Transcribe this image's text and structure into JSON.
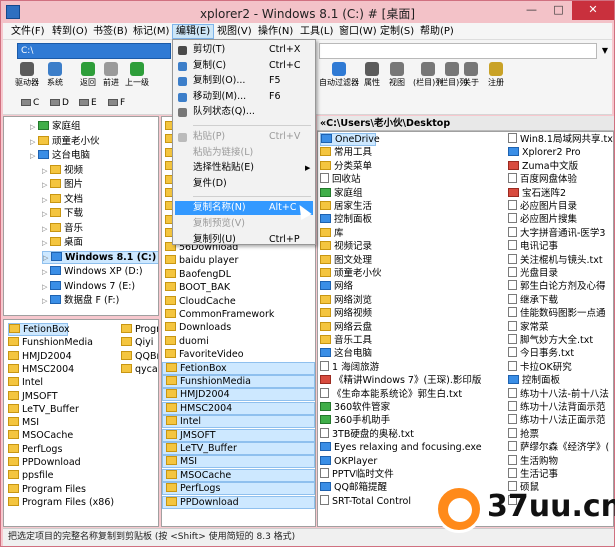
{
  "window": {
    "title": "xplorer2 - Windows 8.1 (C:) # [桌面]",
    "min": "—",
    "max": "□",
    "close": "✕"
  },
  "menubar": [
    "文件(F)",
    "转到(O)",
    "书签(B)",
    "标记(M)",
    "编辑(E)",
    "视图(V)",
    "操作(N)",
    "工具(L)",
    "窗口(W)",
    "定制(S)",
    "帮助(P)"
  ],
  "address": {
    "left_value": "C:\\",
    "right_value": ""
  },
  "toolbar": {
    "left": [
      "驱动器",
      "系统",
      "返回",
      "前进",
      "上一级"
    ],
    "right": [
      "自动过滤器",
      "属性",
      "视图",
      "(栏目)列",
      "(栏目)列",
      "关于",
      "注册"
    ]
  },
  "drives": [
    "C",
    "D",
    "E",
    "F"
  ],
  "tree": [
    {
      "label": "家庭组",
      "indent": 1,
      "icon": "green"
    },
    {
      "label": "顽童老小伙",
      "indent": 1,
      "icon": "folder"
    },
    {
      "label": "这台电脑",
      "indent": 1,
      "icon": "blue"
    },
    {
      "label": "视频",
      "indent": 2,
      "icon": "folder"
    },
    {
      "label": "图片",
      "indent": 2,
      "icon": "folder"
    },
    {
      "label": "文档",
      "indent": 2,
      "icon": "folder"
    },
    {
      "label": "下载",
      "indent": 2,
      "icon": "folder"
    },
    {
      "label": "音乐",
      "indent": 2,
      "icon": "folder"
    },
    {
      "label": "桌面",
      "indent": 2,
      "icon": "folder"
    },
    {
      "label": "Windows 8.1 (C:)",
      "indent": 2,
      "icon": "blue",
      "selected": true
    },
    {
      "label": "Windows XP (D:)",
      "indent": 2,
      "icon": "blue"
    },
    {
      "label": "Windows 7 (E:)",
      "indent": 2,
      "icon": "blue"
    },
    {
      "label": "数据盘 F (F:)",
      "indent": 2,
      "icon": "blue"
    }
  ],
  "bottom_left": {
    "col1": [
      "FetionBox",
      "FunshionMedia",
      "HMJD2004",
      "HMSC2004",
      "Intel",
      "JMSOFT",
      "LeTV_Buffer",
      "MSI",
      "MSOCache",
      "PerfLogs",
      "PPDownload",
      "ppsfile",
      "Program Files",
      "Program Files (x86)"
    ],
    "col2": [
      "Progr",
      "Qiyi",
      "QQBr",
      "qycac"
    ]
  },
  "middle_list": [
    "56Download",
    "baidu player",
    "BaofengDL",
    "BOOT_BAK",
    "CloudCache",
    "CommonFramework",
    "Downloads",
    "duomi",
    "FavoriteVideo",
    "FetionBox",
    "FunshionMedia",
    "HMJD2004",
    "HMSC2004",
    "Intel",
    "JMSOFT",
    "LeTV_Buffer",
    "MSI",
    "MSOCache",
    "PerfLogs",
    "PPDownload"
  ],
  "middle_selected_from": 9,
  "right_pane": {
    "path": "«C:\\Users\\老小伙\\Desktop",
    "col1": [
      {
        "label": "OneDrive",
        "icon": "blue"
      },
      {
        "label": "常用工具",
        "icon": "folder"
      },
      {
        "label": "分类菜单",
        "icon": "folder"
      },
      {
        "label": "回收站",
        "icon": "file"
      },
      {
        "label": "家庭组",
        "icon": "green"
      },
      {
        "label": "居家生活",
        "icon": "folder"
      },
      {
        "label": "控制面板",
        "icon": "blue"
      },
      {
        "label": "库",
        "icon": "folder"
      },
      {
        "label": "视频记录",
        "icon": "folder"
      },
      {
        "label": "图文处理",
        "icon": "folder"
      },
      {
        "label": "顽童老小伙",
        "icon": "folder"
      },
      {
        "label": "网络",
        "icon": "blue"
      },
      {
        "label": "网络浏览",
        "icon": "folder"
      },
      {
        "label": "网络视频",
        "icon": "folder"
      },
      {
        "label": "网络云盘",
        "icon": "folder"
      },
      {
        "label": "音乐工具",
        "icon": "folder"
      },
      {
        "label": "这台电脑",
        "icon": "blue"
      },
      {
        "label": "1 海阔旅游",
        "icon": "file"
      },
      {
        "label": "《精讲Windows 7》(王琛).影印版",
        "icon": "red"
      },
      {
        "label": "《生命本能系统论》郭生白.txt",
        "icon": "file"
      },
      {
        "label": "360软件管家",
        "icon": "green"
      },
      {
        "label": "360手机助手",
        "icon": "green"
      },
      {
        "label": "3TB硬盘的奥秘.txt",
        "icon": "file"
      },
      {
        "label": "Eyes relaxing and focusing.exe",
        "icon": "blue"
      },
      {
        "label": "OKPlayer",
        "icon": "blue"
      },
      {
        "label": "PPTV临时文件",
        "icon": "file"
      },
      {
        "label": "QQ邮箱提醒",
        "icon": "blue"
      },
      {
        "label": "SRT-Total Control",
        "icon": "file"
      }
    ],
    "col2": [
      {
        "label": "Win8.1局域网共享.txt",
        "icon": "file"
      },
      {
        "label": "Xplorer2 Pro",
        "icon": "blue"
      },
      {
        "label": "Zuma中文版",
        "icon": "red"
      },
      {
        "label": "百度网盘体验",
        "icon": "file"
      },
      {
        "label": "宝石迷阵2",
        "icon": "red"
      },
      {
        "label": "必应图片目录",
        "icon": "file"
      },
      {
        "label": "必应图片搜集",
        "icon": "file"
      },
      {
        "label": "大字拼音通讯-医学3",
        "icon": "file"
      },
      {
        "label": "电讯记事",
        "icon": "file"
      },
      {
        "label": "关注棍机与镜头.txt",
        "icon": "file"
      },
      {
        "label": "光盘目录",
        "icon": "file"
      },
      {
        "label": "郭生白论方剂及心得",
        "icon": "file"
      },
      {
        "label": "继承下载",
        "icon": "file"
      },
      {
        "label": "佳能数码图影一点通",
        "icon": "file"
      },
      {
        "label": "家常菜",
        "icon": "file"
      },
      {
        "label": "脚气妙方大全.txt",
        "icon": "file"
      },
      {
        "label": "今日事务.txt",
        "icon": "file"
      },
      {
        "label": "卡拉OK研究",
        "icon": "file"
      },
      {
        "label": "控制面板",
        "icon": "blue"
      },
      {
        "label": "练功十八法-前十八法",
        "icon": "file"
      },
      {
        "label": "练功十八法背面示范",
        "icon": "file"
      },
      {
        "label": "练功十八法正面示范",
        "icon": "file"
      },
      {
        "label": "抢票",
        "icon": "file"
      },
      {
        "label": "萨缪尔森《经济学》(",
        "icon": "file"
      },
      {
        "label": "生活购物",
        "icon": "file"
      },
      {
        "label": "生活记事",
        "icon": "file"
      },
      {
        "label": "硕鼠",
        "icon": "file"
      },
      {
        "label": "",
        "icon": "file"
      }
    ]
  },
  "edit_menu": [
    {
      "label": "剪切(T)",
      "shortcut": "Ctrl+X",
      "state": "normal",
      "icon": "#4a4a4a"
    },
    {
      "label": "复制(C)",
      "shortcut": "Ctrl+C",
      "state": "normal",
      "icon": "#3c7ec9"
    },
    {
      "label": "复制到(O)...",
      "shortcut": "F5",
      "state": "normal",
      "icon": "#3c7ec9"
    },
    {
      "label": "移动到(M)...",
      "shortcut": "F6",
      "state": "normal",
      "icon": "#3c7ec9"
    },
    {
      "label": "队列状态(Q)...",
      "shortcut": "",
      "state": "normal",
      "icon": "#777777"
    },
    {
      "sep": true
    },
    {
      "label": "粘贴(P)",
      "shortcut": "Ctrl+V",
      "state": "disabled",
      "icon": "#bbbbbb"
    },
    {
      "label": "粘贴为链接(L)",
      "shortcut": "",
      "state": "disabled",
      "icon": ""
    },
    {
      "label": "选择性粘贴(E)",
      "shortcut": "",
      "state": "normal",
      "icon": "",
      "submenu": true
    },
    {
      "label": "复件(D)",
      "shortcut": "",
      "state": "normal",
      "icon": ""
    },
    {
      "sep": true
    },
    {
      "label": "复制名称(N)",
      "shortcut": "Alt+C",
      "state": "hot",
      "icon": ""
    },
    {
      "label": "复制预览(V)",
      "shortcut": "",
      "state": "disabled",
      "icon": ""
    },
    {
      "label": "复制列(U)",
      "shortcut": "Ctrl+P",
      "state": "normal",
      "icon": ""
    }
  ],
  "statusbar": "把选定项目的完整名称复制到剪贴板 (按 <Shift> 使用简短的 8.3 格式)",
  "watermark": {
    "text": "37uu.cn"
  }
}
